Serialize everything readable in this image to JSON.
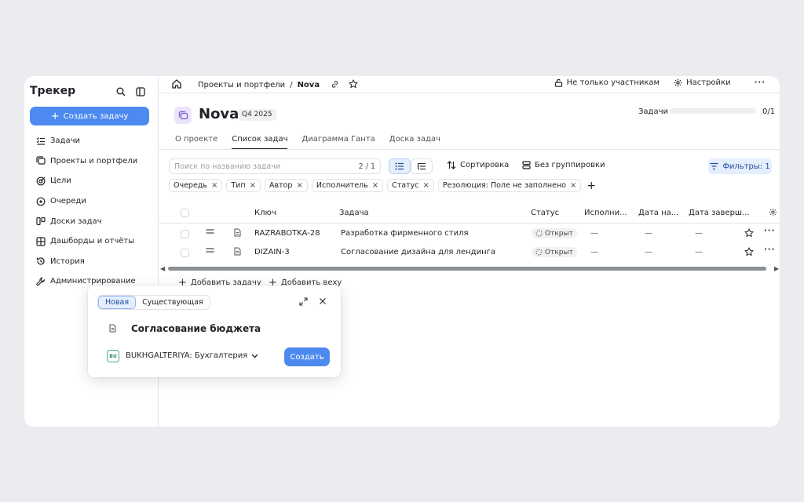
{
  "sidebar": {
    "logo": "Трекер",
    "create_label": "Создать задачу",
    "items": [
      {
        "label": "Задачи",
        "icon": "tasks-icon"
      },
      {
        "label": "Проекты и портфели",
        "icon": "projects-icon"
      },
      {
        "label": "Цели",
        "icon": "goals-icon"
      },
      {
        "label": "Очереди",
        "icon": "queues-icon"
      },
      {
        "label": "Доски задач",
        "icon": "boards-icon"
      },
      {
        "label": "Дашборды и отчёты",
        "icon": "dashboards-icon"
      },
      {
        "label": "История",
        "icon": "history-icon"
      },
      {
        "label": "Администрирование",
        "icon": "admin-icon"
      }
    ]
  },
  "topbar": {
    "breadcrumb_parent": "Проекты и портфели",
    "breadcrumb_sep": "/",
    "breadcrumb_current": "Nova",
    "access_label": "Не только участникам",
    "settings_label": "Настройки"
  },
  "project": {
    "title": "Nova",
    "quarter": "Q4 2025",
    "progress_label": "Задачи",
    "progress_count": "0/1",
    "progress_fraction": 0
  },
  "tabs": [
    "О проекте",
    "Список задач",
    "Диаграмма Ганта",
    "Доска задач"
  ],
  "toolbar": {
    "search_placeholder": "Поиск по названию задачи",
    "search_count": "2 / 1",
    "sort_label": "Сортировка",
    "group_label": "Без группировки",
    "filters_label": "Фильтры: 1"
  },
  "chips": [
    "Очередь",
    "Тип",
    "Автор",
    "Исполнитель",
    "Статус",
    "Резолюция: Поле не заполнено"
  ],
  "table": {
    "headers": {
      "key": "Ключ",
      "task": "Задача",
      "status": "Статус",
      "assignee": "Исполни...",
      "start": "Дата на...",
      "end": "Дата заверш..."
    },
    "rows": [
      {
        "key": "RAZRABOTKA-28",
        "task": "Разработка фирменного стиля",
        "status": "Открыт",
        "assignee": "—",
        "start": "—",
        "end": "—"
      },
      {
        "key": "DIZAIN-3",
        "task": "Согласование дизайна для лендинга",
        "status": "Открыт",
        "assignee": "—",
        "start": "—",
        "end": "—"
      }
    ],
    "add_task": "Добавить задачу",
    "add_milestone": "Добавить веху"
  },
  "popup": {
    "seg_new": "Новая",
    "seg_existing": "Существующая",
    "task_title": "Согласование бюджета",
    "queue_badge": "BU",
    "queue_label": "BUKHGALTERIYA: Бухгалтерия",
    "create_label": "Создать"
  },
  "colors": {
    "accent": "#4d8af0",
    "background": "#eaecef"
  }
}
